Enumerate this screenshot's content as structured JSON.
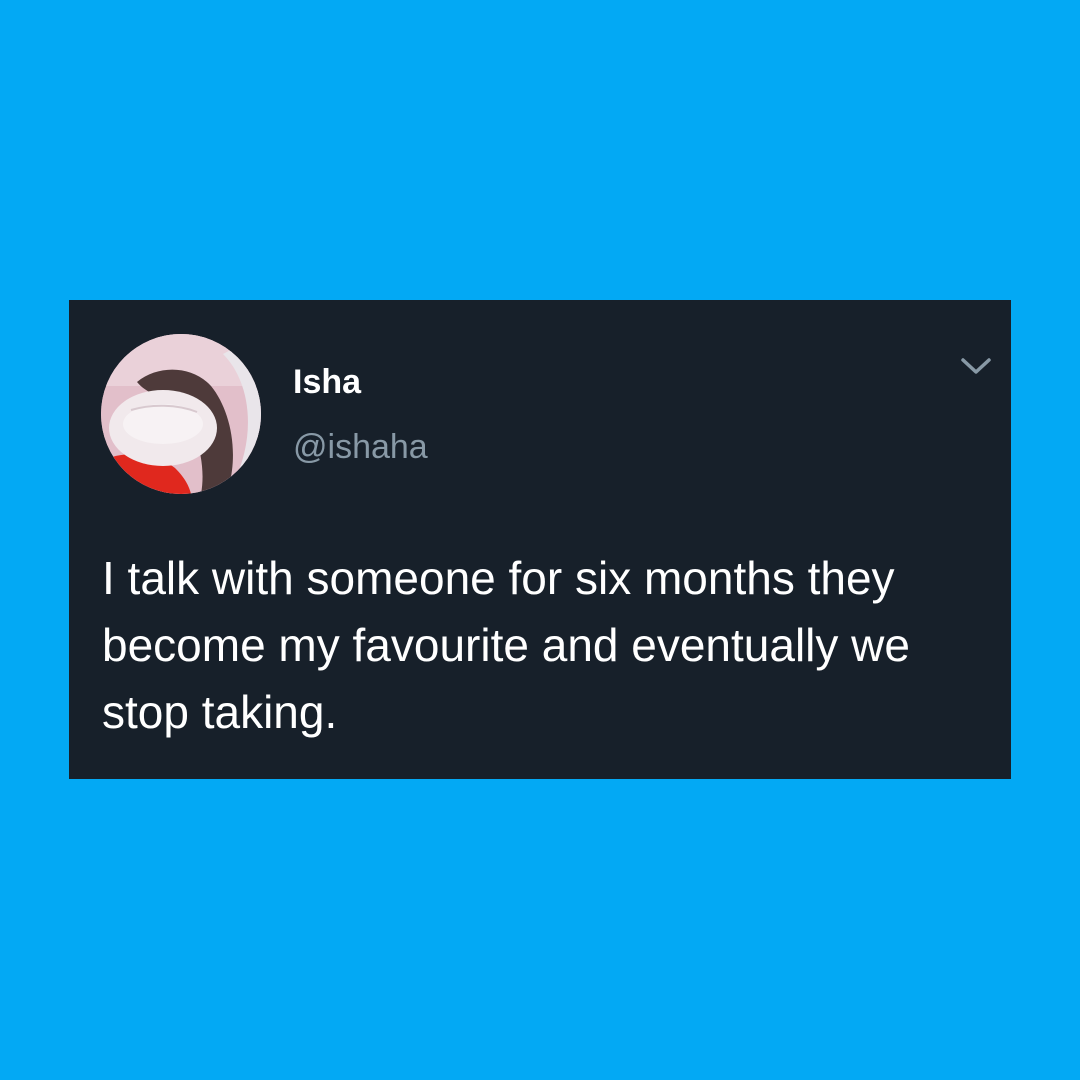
{
  "tweet": {
    "display_name": "Isha",
    "handle": "@ishaha",
    "text": "I talk with someone for six months they become my favourite and eventually we stop taking."
  },
  "icons": {
    "menu": "chevron-down-icon"
  },
  "colors": {
    "background": "#03a9f4",
    "card": "#17202a",
    "name_text": "#ffffff",
    "handle_text": "#8899a6",
    "body_text": "#ffffff"
  }
}
